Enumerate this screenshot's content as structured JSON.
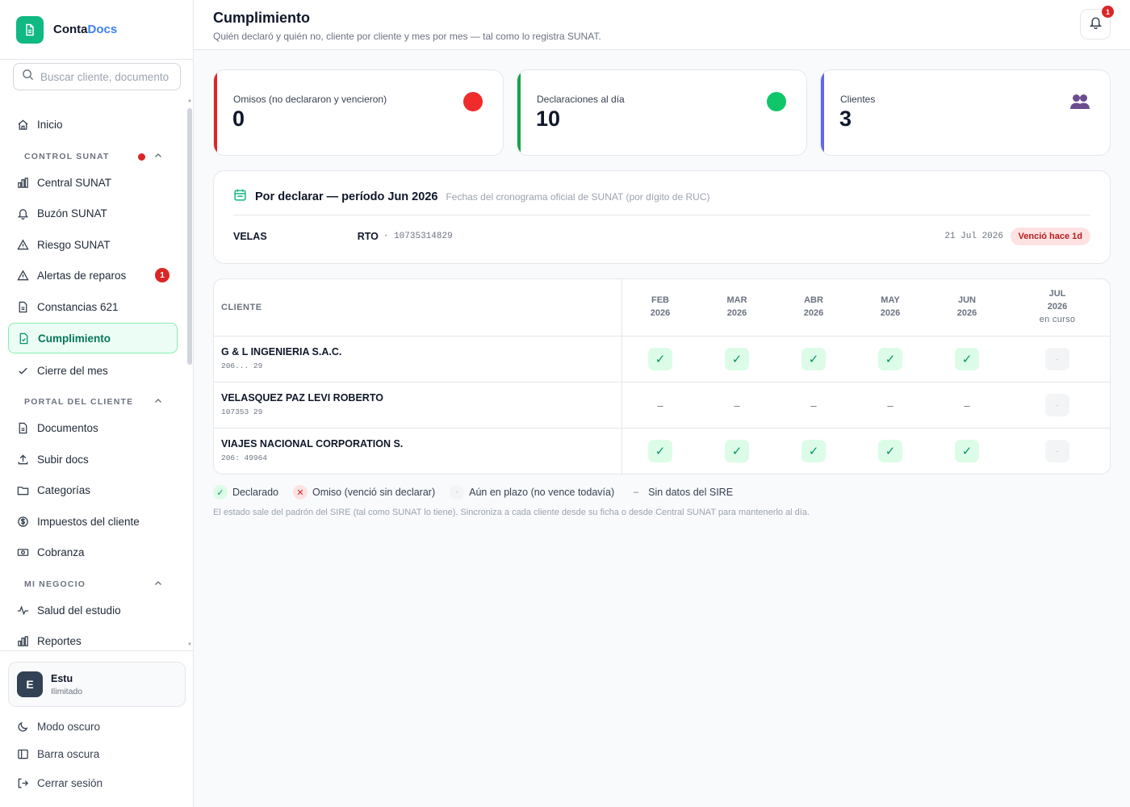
{
  "app": {
    "brand_primary": "Conta",
    "brand_accent": "Docs"
  },
  "search": {
    "placeholder": "Buscar cliente, documento…"
  },
  "nav": {
    "inicio": "Inicio",
    "sections": {
      "control_sunat": "CONTROL SUNAT",
      "portal_cliente": "PORTAL DEL CLIENTE",
      "mi_negocio": "MI NEGOCIO"
    },
    "central_sunat": "Central SUNAT",
    "buzon_sunat": "Buzón SUNAT",
    "riesgo_sunat": "Riesgo SUNAT",
    "alertas_reparos": "Alertas de reparos",
    "alertas_badge": "1",
    "constancias": "Constancias 621",
    "cumplimiento": "Cumplimiento",
    "cierre_mes": "Cierre del mes",
    "documentos": "Documentos",
    "subir_docs": "Subir docs",
    "categorias": "Categorías",
    "impuestos_cliente": "Impuestos del cliente",
    "cobranza": "Cobranza",
    "salud_estudio": "Salud del estudio",
    "reportes": "Reportes"
  },
  "account": {
    "avatar_letter": "E",
    "name": "Estu",
    "plan": "Ilimitado"
  },
  "bottom": {
    "dark_mode": "Modo oscuro",
    "dark_bar": "Barra oscura",
    "logout": "Cerrar sesión"
  },
  "header": {
    "title": "Cumplimiento",
    "subtitle": "Quién declaró y quién no, cliente por cliente y mes por mes — tal como lo registra SUNAT.",
    "notif_count": "1"
  },
  "stats": {
    "omisos": {
      "label": "Omisos (no declararon y vencieron)",
      "value": "0",
      "color": "#dc2626"
    },
    "al_dia": {
      "label": "Declaraciones al día",
      "value": "10",
      "color": "#16a34a"
    },
    "clientes": {
      "label": "Clientes",
      "value": "3",
      "color": "#6366f1"
    }
  },
  "pending": {
    "title": "Por declarar — período Jun 2026",
    "note": "Fechas del cronograma oficial de SUNAT (por dígito de RUC)",
    "row": {
      "name": "VELAS",
      "name_tail": "RTO",
      "separator": "·",
      "ruc": "10735314829",
      "date": "21 Jul 2026",
      "status": "Venció hace 1d"
    }
  },
  "table": {
    "client_header": "CLIENTE",
    "months": [
      {
        "m": "FEB",
        "y": "2026",
        "sub": ""
      },
      {
        "m": "MAR",
        "y": "2026",
        "sub": ""
      },
      {
        "m": "ABR",
        "y": "2026",
        "sub": ""
      },
      {
        "m": "MAY",
        "y": "2026",
        "sub": ""
      },
      {
        "m": "JUN",
        "y": "2026",
        "sub": ""
      },
      {
        "m": "JUL",
        "y": "2026",
        "sub": "en curso"
      }
    ],
    "rows": [
      {
        "name": "G & L INGENIERIA S.A.C.",
        "ruc": "206...   29",
        "cells": [
          "ok",
          "ok",
          "ok",
          "ok",
          "ok",
          "pend"
        ]
      },
      {
        "name": "VELASQUEZ PAZ LEVI ROBERTO",
        "ruc": "107353    29",
        "cells": [
          "none",
          "none",
          "none",
          "none",
          "none",
          "pend"
        ]
      },
      {
        "name": "VIAJES NACIONAL CORPORATION S.",
        "ruc": "206:  49964",
        "cells": [
          "ok",
          "ok",
          "ok",
          "ok",
          "ok",
          "pend"
        ]
      }
    ]
  },
  "symbols": {
    "ok": "✓",
    "omit": "✕",
    "pend": "·",
    "none": "–"
  },
  "legend": {
    "declarado": "Declarado",
    "omiso": "Omiso (venció sin declarar)",
    "plazo": "Aún en plazo (no vence todavía)",
    "sin_datos": "Sin datos del SIRE"
  },
  "footnote": "El estado sale del padrón del SIRE (tal como SUNAT lo tiene). Sincroniza a cada cliente desde su ficha o desde Central SUNAT para mantenerlo al día."
}
